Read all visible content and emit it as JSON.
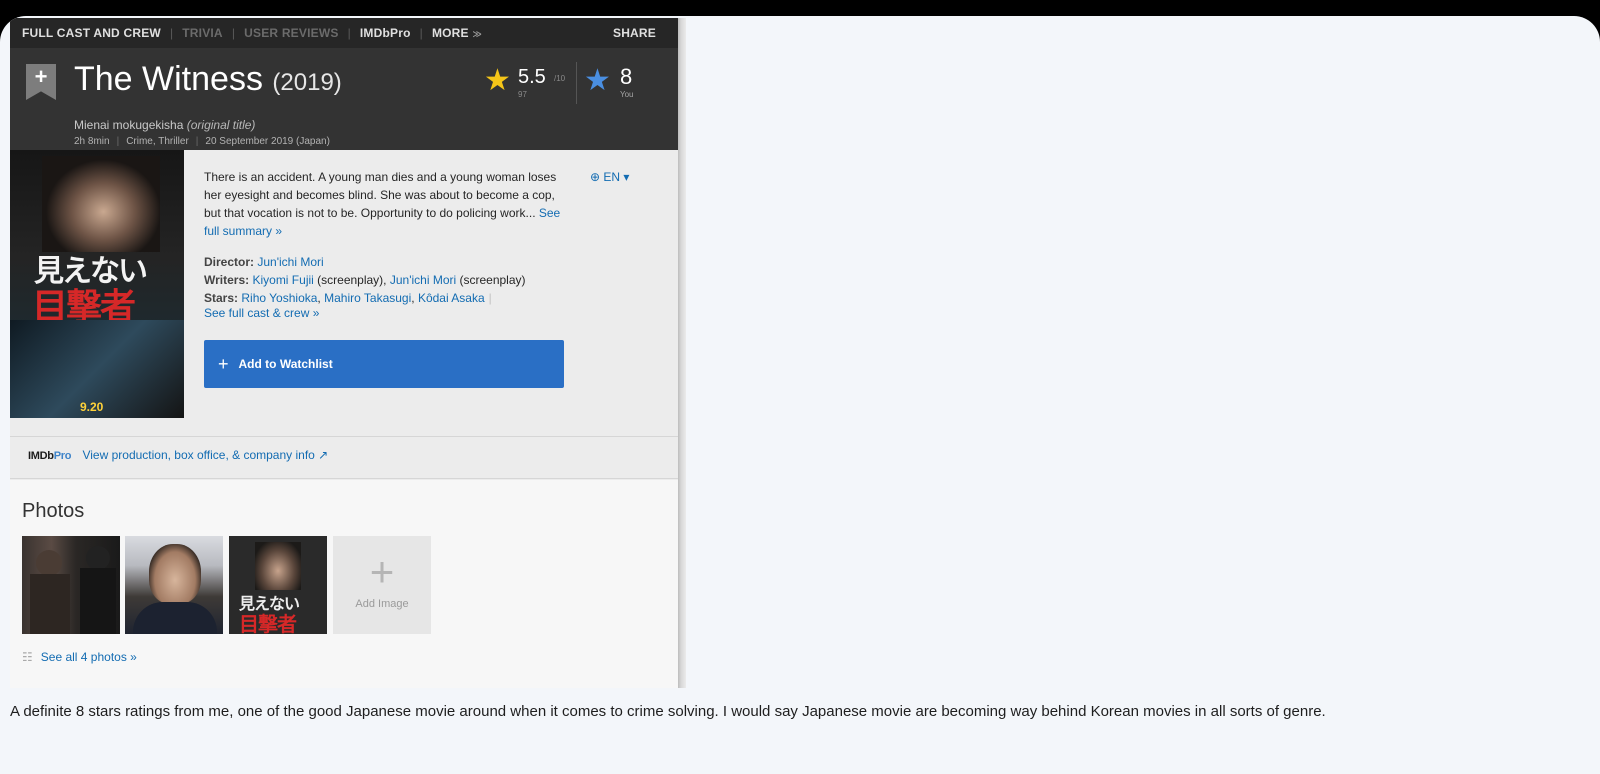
{
  "nav": {
    "items": [
      "FULL CAST AND CREW",
      "TRIVIA",
      "USER REVIEWS",
      "IMDbPro",
      "MORE"
    ],
    "more_chevron": "≫",
    "share": "SHARE"
  },
  "movie": {
    "title": "The Witness",
    "year": "(2019)",
    "original_title": "Mienai mokugekisha",
    "original_title_note": "(original title)",
    "runtime": "2h 8min",
    "genres": "Crime, Thriller",
    "release": "20 September 2019 (Japan)",
    "rating": "5.5",
    "rating_max": "/10",
    "votes": "97",
    "user_rating": "8",
    "user_rating_label": "You"
  },
  "poster": {
    "jp_line1": "見えない",
    "jp_line2": "目撃者",
    "date": "9.20"
  },
  "summary": {
    "text": "There is an accident. A young man dies and a young woman loses her eyesight and becomes blind. She was about to become a cop, but that vocation is not to be. Opportunity to do policing work... ",
    "see_full": "See full summary »",
    "lang": "EN ▾"
  },
  "credits": {
    "director_label": "Director:",
    "director": "Jun'ichi Mori",
    "writers_label": "Writers:",
    "writer1": "Kiyomi Fujii",
    "writer1_role": " (screenplay), ",
    "writer2": "Jun'ichi Mori",
    "writer2_role": " (screenplay)",
    "stars_label": "Stars:",
    "star1": "Riho Yoshioka",
    "star2": "Mahiro Takasugi",
    "star3": "Kôdai Asaka",
    "see_cast": "See full cast & crew »"
  },
  "watchlist": {
    "plus": "+",
    "label": "Add to Watchlist"
  },
  "pro": {
    "logo_a": "IMDb",
    "logo_b": "Pro",
    "link": "View production, box office, & company info ↗"
  },
  "photos": {
    "title": "Photos",
    "thumb3_jp1": "見えない",
    "thumb3_jp2": "目撃者",
    "add_plus": "+",
    "add_label": "Add Image",
    "see_all": "See all 4 photos »"
  },
  "comment": "A definite 8 stars ratings from me, one of the good Japanese movie around when it comes to crime solving. I would say Japanese movie are becoming way behind Korean movies in all sorts of genre."
}
